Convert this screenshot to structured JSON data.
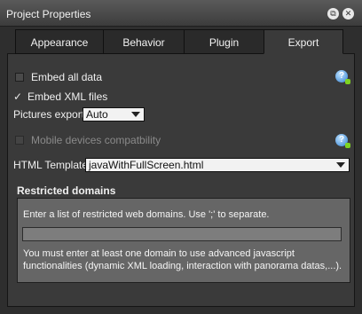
{
  "window": {
    "title": "Project Properties"
  },
  "tabs": [
    {
      "label": "Appearance"
    },
    {
      "label": "Behavior"
    },
    {
      "label": "Plugin"
    },
    {
      "label": "Export"
    }
  ],
  "export": {
    "embed_all_data": {
      "label": "Embed all data",
      "checked": false
    },
    "embed_xml_files": {
      "label": "Embed XML files",
      "checked": true
    },
    "pictures_export": {
      "label": "Pictures export",
      "value": "Auto"
    },
    "mobile_devices": {
      "label": "Mobile devices compatbility",
      "checked": false,
      "enabled": false
    },
    "html_template": {
      "label": "HTML Template",
      "value": "javaWithFullScreen.html"
    },
    "restricted_domains": {
      "title": "Restricted domains",
      "hint": "Enter a list of restricted web domains. Use ';' to separate.",
      "value": "",
      "note": "You must enter at least one domain to use advanced javascript functionalities (dynamic XML loading, interaction with panorama datas,...)."
    }
  },
  "icons": {
    "help": "help-icon"
  },
  "colors": {
    "accent": "#2f7fd1",
    "panel": "#3a3a3a",
    "titlebar": "#4a4a4a"
  }
}
